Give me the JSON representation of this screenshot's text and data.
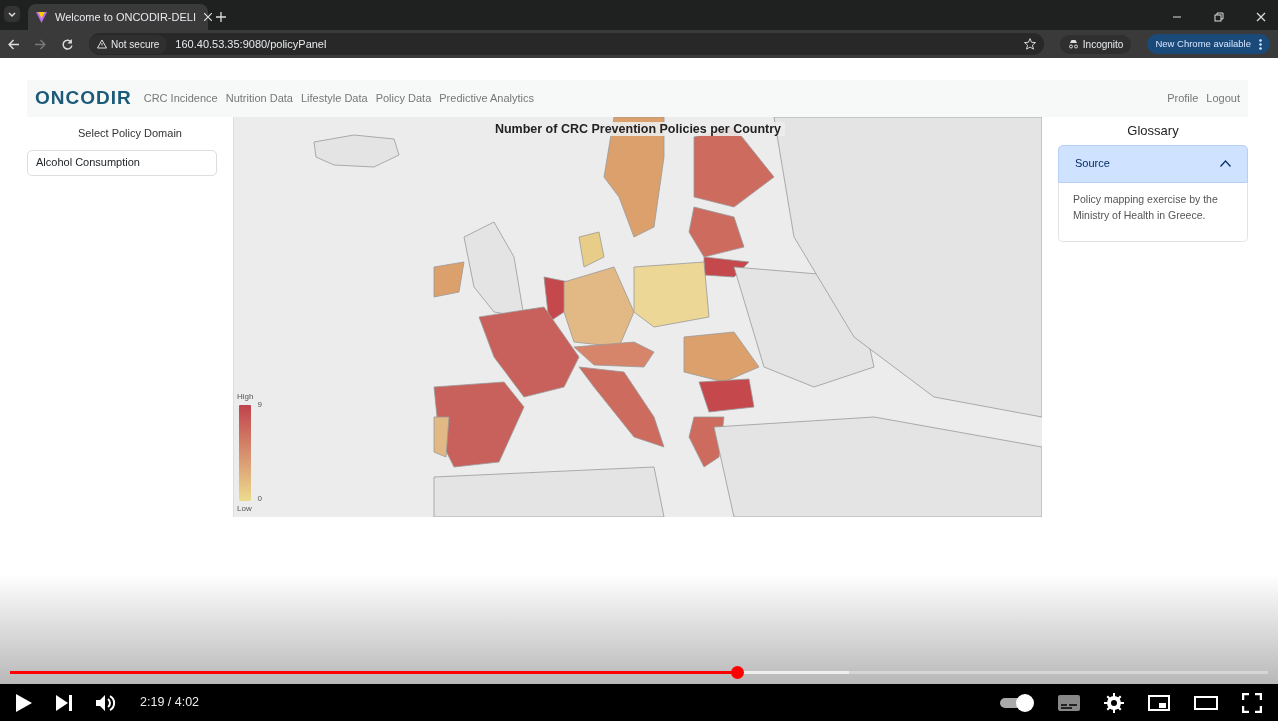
{
  "browser": {
    "tab": {
      "title": "Welcome to ONCODIR-DELI",
      "selected": true
    },
    "security": "Not secure",
    "url": "160.40.53.35:9080/policyPanel",
    "profile": "Incognito",
    "update": "New Chrome available"
  },
  "navbar": {
    "brand": "ONCODIR",
    "links": [
      {
        "label": "CRC Incidence"
      },
      {
        "label": "Nutrition Data"
      },
      {
        "label": "Lifestyle Data"
      },
      {
        "label": "Policy Data"
      },
      {
        "label": "Predictive Analytics"
      }
    ],
    "right_links": [
      {
        "label": "Profile"
      },
      {
        "label": "Logout"
      }
    ]
  },
  "sidebar": {
    "label": "Select Policy Domain",
    "value": "Alcohol Consumption"
  },
  "map": {
    "title": "Number of CRC Prevention Policies per Country",
    "legend": {
      "high_label": "High",
      "max": "9",
      "min": "0",
      "low_label": "Low"
    }
  },
  "glossary": {
    "title": "Glossary",
    "items": [
      {
        "header": "Source",
        "expanded": true,
        "body": "Policy mapping exercise by the Ministry of Health in Greece."
      }
    ]
  },
  "player": {
    "progress": {
      "level": 0.578
    },
    "buffer": {
      "level": 0.667
    },
    "time": "2:19 / 4:02",
    "autoplay": {
      "on": true
    }
  }
}
